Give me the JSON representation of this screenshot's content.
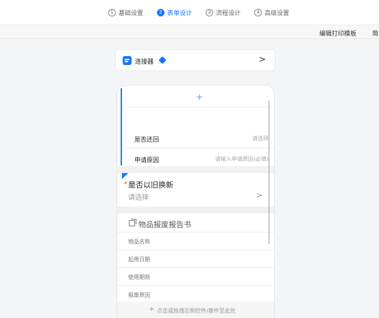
{
  "steps": [
    {
      "num": "1",
      "label": "基础设置",
      "active": false
    },
    {
      "num": "2",
      "label": "表单设计",
      "active": true
    },
    {
      "num": "3",
      "label": "流程设计",
      "active": false
    },
    {
      "num": "4",
      "label": "高级设置",
      "active": false
    }
  ],
  "toolbar": {
    "print_template": "编辑打印模板",
    "simple": "简"
  },
  "connector": {
    "label": "连接器",
    "chevron": ">"
  },
  "form": {
    "add_plus": "+",
    "fields": [
      {
        "label": "是否还回",
        "placeholder": "请选择"
      },
      {
        "label": "申请原因",
        "placeholder": "请输入申请原因(必填)"
      }
    ],
    "new_field": {
      "required_mark": "*",
      "label": "是否以旧换新",
      "placeholder": "请选择",
      "chevron": ">"
    },
    "sub_table": {
      "title": "物品报废报告书",
      "rows": [
        "物品名称",
        "起用日期",
        "使用期限",
        "报废原因"
      ]
    },
    "drop_hint": {
      "plus": "+",
      "text": "点击或拖拽左侧控件/套件至此处"
    }
  },
  "colors": {
    "accent": "#1677ff",
    "required": "#f5222d"
  }
}
